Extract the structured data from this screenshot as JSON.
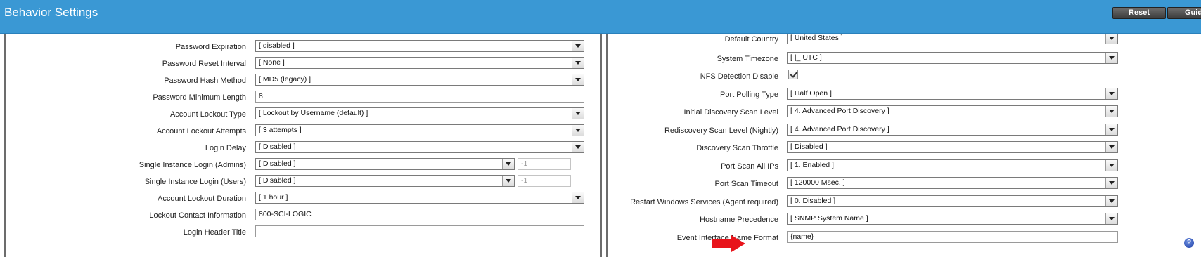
{
  "header": {
    "title": "Behavior Settings",
    "reset_label": "Reset",
    "guide_label": "Guide"
  },
  "left_rows": [
    {
      "label": "Password Expiration",
      "value": "[ disabled ]",
      "type": "select"
    },
    {
      "label": "Password Reset Interval",
      "value": "[ None ]",
      "type": "select"
    },
    {
      "label": "Password Hash Method",
      "value": "[ MD5 (legacy) ]",
      "type": "select"
    },
    {
      "label": "Password Minimum Length",
      "value": "8",
      "type": "text"
    },
    {
      "label": "Account Lockout Type",
      "value": "[ Lockout by Username (default) ]",
      "type": "select"
    },
    {
      "label": "Account Lockout Attempts",
      "value": "[ 3 attempts ]",
      "type": "select"
    },
    {
      "label": "Login Delay",
      "value": "[ Disabled ]",
      "type": "select"
    },
    {
      "label": "Single Instance Login (Admins)",
      "value": "[ Disabled ]",
      "extra": "-1",
      "type": "select-extra"
    },
    {
      "label": "Single Instance Login (Users)",
      "value": "[ Disabled ]",
      "extra": "-1",
      "type": "select-extra"
    },
    {
      "label": "Account Lockout Duration",
      "value": "[ 1 hour ]",
      "type": "select"
    },
    {
      "label": "Lockout Contact Information",
      "value": "800-SCI-LOGIC",
      "type": "text"
    },
    {
      "label": "Login Header Title",
      "value": "",
      "type": "text"
    }
  ],
  "right_rows": [
    {
      "label": "Default Country",
      "value": "[ United States ]",
      "type": "select"
    },
    {
      "label": "System Timezone",
      "value": "[ |_ UTC ]",
      "type": "select"
    },
    {
      "label": "NFS Detection Disable",
      "value": "",
      "type": "checkbox",
      "checked": true
    },
    {
      "label": "Port Polling Type",
      "value": "[ Half Open ]",
      "type": "select"
    },
    {
      "label": "Initial Discovery Scan Level",
      "value": "[ 4. Advanced Port Discovery ]",
      "type": "select"
    },
    {
      "label": "Rediscovery Scan Level (Nightly)",
      "value": "[ 4. Advanced Port Discovery ]",
      "type": "select"
    },
    {
      "label": "Discovery Scan Throttle",
      "value": "[ Disabled ]",
      "type": "select"
    },
    {
      "label": "Port Scan All IPs",
      "value": "[ 1. Enabled ]",
      "type": "select"
    },
    {
      "label": "Port Scan Timeout",
      "value": "[ 120000 Msec. ]",
      "type": "select"
    },
    {
      "label": "Restart Windows Services (Agent required)",
      "value": "[ 0. Disabled ]",
      "type": "select"
    },
    {
      "label": "Hostname Precedence",
      "value": "[ SNMP System Name ]",
      "type": "select"
    },
    {
      "label": "Event Interface Name Format",
      "value": "{name}",
      "type": "text",
      "highlight": true
    }
  ],
  "help_icon_glyph": "?",
  "colors": {
    "header_bg": "#3a98d4",
    "arrow_red": "#e8141b"
  }
}
